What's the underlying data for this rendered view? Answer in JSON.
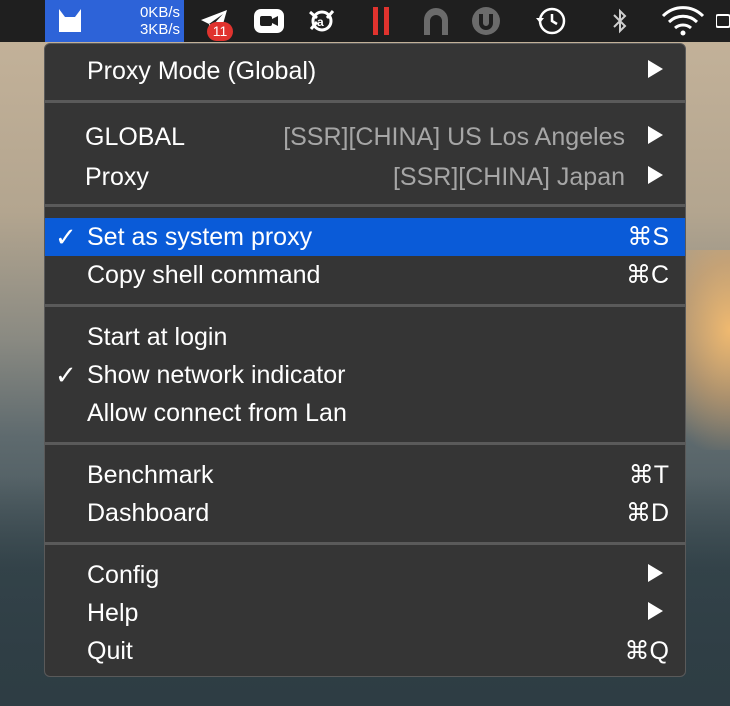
{
  "menubar": {
    "net_up": "0KB/s",
    "net_down": "3KB/s",
    "telegram_badge": "11",
    "icons": [
      "clashx-cat-icon",
      "telegram-icon",
      "zoom-icon",
      "avast-icon",
      "parallels-icon",
      "archive-icon",
      "ublock-icon",
      "time-machine-icon",
      "bluetooth-icon",
      "wifi-icon"
    ]
  },
  "menu": {
    "proxy_mode": "Proxy Mode (Global)",
    "global_label": "GLOBAL",
    "global_value": "[SSR][CHINA] US Los Angeles",
    "proxy_label": "Proxy",
    "proxy_value": "[SSR][CHINA] Japan",
    "set_system_proxy": "Set as system proxy",
    "set_system_proxy_shortcut": "⌘S",
    "copy_shell": "Copy shell command",
    "copy_shell_shortcut": "⌘C",
    "start_at_login": "Start at login",
    "show_network": "Show network indicator",
    "allow_lan": "Allow connect from Lan",
    "benchmark": "Benchmark",
    "benchmark_shortcut": "⌘T",
    "dashboard": "Dashboard",
    "dashboard_shortcut": "⌘D",
    "config": "Config",
    "help": "Help",
    "quit": "Quit",
    "quit_shortcut": "⌘Q",
    "checkmark": "✓"
  },
  "colors": {
    "menu_bg": "#353535",
    "highlight": "#0a5bd8",
    "menubar_active": "#2d63d8",
    "badge": "#e0332e"
  }
}
